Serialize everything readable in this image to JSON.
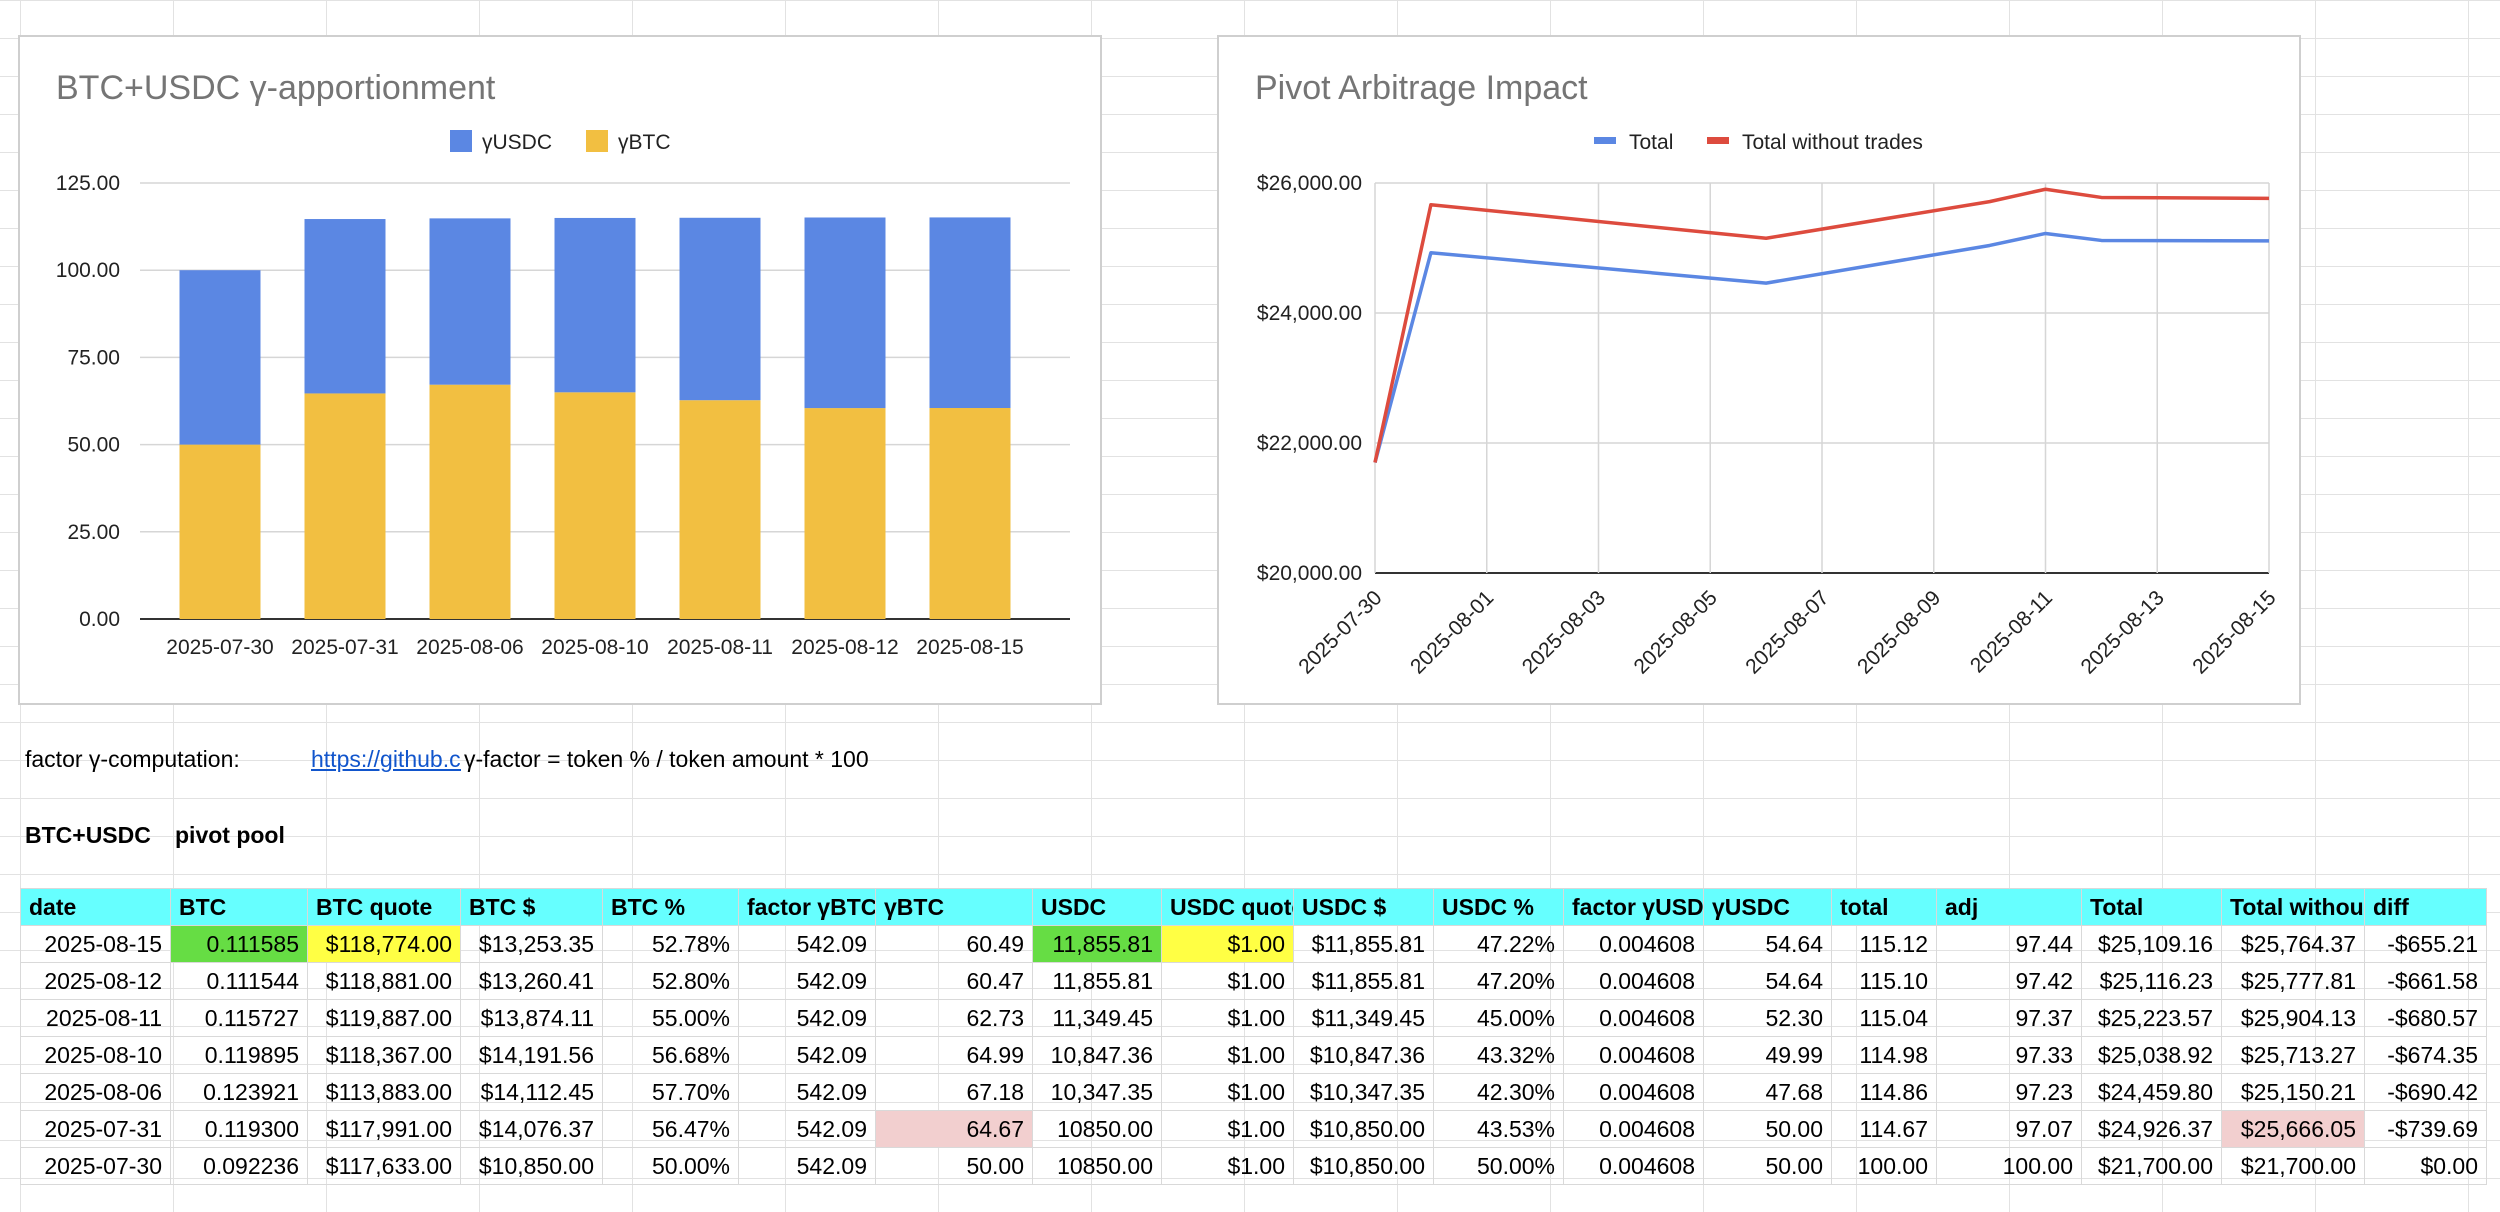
{
  "charts": {
    "bar": {
      "title": "BTC+USDC γ-apportionment",
      "legend": [
        {
          "name": "γUSDC",
          "color": "#5b87e3"
        },
        {
          "name": "γBTC",
          "color": "#f2bf41"
        }
      ]
    },
    "line": {
      "title": "Pivot Arbitrage Impact",
      "legend": [
        {
          "name": "Total",
          "color": "#5b87e3"
        },
        {
          "name": "Total without trades",
          "color": "#dd4b3e"
        }
      ]
    }
  },
  "chart_data": [
    {
      "type": "bar",
      "stacked": true,
      "title": "BTC+USDC γ-apportionment",
      "categories": [
        "2025-07-30",
        "2025-07-31",
        "2025-08-06",
        "2025-08-10",
        "2025-08-11",
        "2025-08-12",
        "2025-08-15"
      ],
      "series": [
        {
          "name": "γBTC",
          "values": [
            50.0,
            64.67,
            67.18,
            64.99,
            62.73,
            60.47,
            60.49
          ],
          "color": "#f2bf41"
        },
        {
          "name": "γUSDC",
          "values": [
            50.0,
            50.0,
            47.68,
            49.99,
            52.3,
            54.64,
            54.64
          ],
          "color": "#5b87e3"
        }
      ],
      "ylim": [
        0,
        125
      ],
      "yticks": [
        "0.00",
        "25.00",
        "50.00",
        "75.00",
        "100.00",
        "125.00"
      ],
      "legend": "top",
      "grid": true
    },
    {
      "type": "line",
      "title": "Pivot Arbitrage Impact",
      "x": [
        "2025-07-30",
        "2025-07-31",
        "2025-08-06",
        "2025-08-10",
        "2025-08-11",
        "2025-08-12",
        "2025-08-15"
      ],
      "series": [
        {
          "name": "Total",
          "values": [
            21700.0,
            24926.37,
            24459.8,
            25038.92,
            25223.57,
            25116.23,
            25109.16
          ],
          "color": "#5b87e3"
        },
        {
          "name": "Total without trades",
          "values": [
            21700.0,
            25666.05,
            25150.21,
            25713.27,
            25904.13,
            25777.81,
            25764.37
          ],
          "color": "#dd4b3e"
        }
      ],
      "ylim": [
        20000,
        26000
      ],
      "yticks": [
        "$20,000.00",
        "$22,000.00",
        "$24,000.00",
        "$26,000.00"
      ],
      "xticks": [
        "2025-07-30",
        "2025-08-01",
        "2025-08-03",
        "2025-08-05",
        "2025-08-07",
        "2025-08-09",
        "2025-08-11",
        "2025-08-13",
        "2025-08-15"
      ],
      "legend": "top",
      "grid": true
    }
  ],
  "notes": {
    "factor_label": "factor γ-computation:",
    "link_text": "https://github.com/",
    "formula": "γ-factor = token % / token amount * 100"
  },
  "section": {
    "col1": "BTC+USDC",
    "col2": "pivot pool"
  },
  "table": {
    "headers": [
      "date",
      "BTC",
      "BTC quote",
      "BTC $",
      "BTC %",
      "factor γBTC",
      "γBTC",
      "USDC",
      "USDC quote",
      "USDC $",
      "USDC %",
      "factor γUSDC",
      "γUSDC",
      "total",
      "adj",
      "Total",
      "Total without trades",
      "diff"
    ],
    "rows": [
      [
        "2025-08-15",
        "0.111585",
        "$118,774.00",
        "$13,253.35",
        "52.78%",
        "542.09",
        "60.49",
        "11,855.81",
        "$1.00",
        "$11,855.81",
        "47.22%",
        "0.004608",
        "54.64",
        "115.12",
        "97.44",
        "$25,109.16",
        "$25,764.37",
        "-$655.21"
      ],
      [
        "2025-08-12",
        "0.111544",
        "$118,881.00",
        "$13,260.41",
        "52.80%",
        "542.09",
        "60.47",
        "11,855.81",
        "$1.00",
        "$11,855.81",
        "47.20%",
        "0.004608",
        "54.64",
        "115.10",
        "97.42",
        "$25,116.23",
        "$25,777.81",
        "-$661.58"
      ],
      [
        "2025-08-11",
        "0.115727",
        "$119,887.00",
        "$13,874.11",
        "55.00%",
        "542.09",
        "62.73",
        "11,349.45",
        "$1.00",
        "$11,349.45",
        "45.00%",
        "0.004608",
        "52.30",
        "115.04",
        "97.37",
        "$25,223.57",
        "$25,904.13",
        "-$680.57"
      ],
      [
        "2025-08-10",
        "0.119895",
        "$118,367.00",
        "$14,191.56",
        "56.68%",
        "542.09",
        "64.99",
        "10,847.36",
        "$1.00",
        "$10,847.36",
        "43.32%",
        "0.004608",
        "49.99",
        "114.98",
        "97.33",
        "$25,038.92",
        "$25,713.27",
        "-$674.35"
      ],
      [
        "2025-08-06",
        "0.123921",
        "$113,883.00",
        "$14,112.45",
        "57.70%",
        "542.09",
        "67.18",
        "10,347.35",
        "$1.00",
        "$10,347.35",
        "42.30%",
        "0.004608",
        "47.68",
        "114.86",
        "97.23",
        "$24,459.80",
        "$25,150.21",
        "-$690.42"
      ],
      [
        "2025-07-31",
        "0.119300",
        "$117,991.00",
        "$14,076.37",
        "56.47%",
        "542.09",
        "64.67",
        "10850.00",
        "$1.00",
        "$10,850.00",
        "43.53%",
        "0.004608",
        "50.00",
        "114.67",
        "97.07",
        "$24,926.37",
        "$25,666.05",
        "-$739.69"
      ],
      [
        "2025-07-30",
        "0.092236",
        "$117,633.00",
        "$10,850.00",
        "50.00%",
        "542.09",
        "50.00",
        "10850.00",
        "$1.00",
        "$10,850.00",
        "50.00%",
        "0.004608",
        "50.00",
        "100.00",
        "100.00",
        "$21,700.00",
        "$21,700.00",
        "$0.00"
      ]
    ],
    "highlights": {
      "green": "#66dd44",
      "yellow": "#ffff44",
      "pink": "#f2cfcf",
      "header": "#66ffff"
    }
  }
}
